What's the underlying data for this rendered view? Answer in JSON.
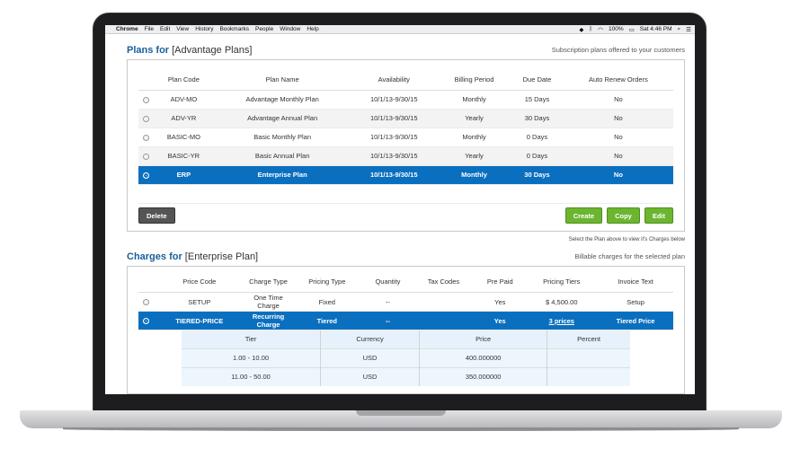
{
  "menubar": {
    "apple": "",
    "items": [
      "Chrome",
      "File",
      "Edit",
      "View",
      "History",
      "Bookmarks",
      "People",
      "Window",
      "Help"
    ],
    "battery": "100%",
    "clock": "Sat 4:46 PM"
  },
  "plans": {
    "title_prefix": "Plans for ",
    "title_bracket": "[Advantage Plans]",
    "subtitle": "Subscription plans offered to your customers",
    "headers": [
      "Plan Code",
      "Plan Name",
      "Availability",
      "Billing Period",
      "Due Date",
      "Auto Renew Orders"
    ],
    "rows": [
      [
        "ADV-MO",
        "Advantage Monthly Plan",
        "10/1/13-9/30/15",
        "Monthly",
        "15 Days",
        "No"
      ],
      [
        "ADV-YR",
        "Advantage Annual Plan",
        "10/1/13-9/30/15",
        "Yearly",
        "30 Days",
        "No"
      ],
      [
        "BASIC-MO",
        "Basic Monthly Plan",
        "10/1/13-9/30/15",
        "Monthly",
        "0 Days",
        "No"
      ],
      [
        "BASIC-YR",
        "Basic Annual Plan",
        "10/1/13-9/30/15",
        "Yearly",
        "0 Days",
        "No"
      ],
      [
        "ERP",
        "Enterprise Plan",
        "10/1/13-9/30/15",
        "Monthly",
        "30 Days",
        "No"
      ]
    ],
    "selected_index": 4,
    "delete_label": "Delete",
    "create_label": "Create",
    "copy_label": "Copy",
    "edit_label": "Edit",
    "note": "Select the Plan above to view it's Charges below"
  },
  "charges": {
    "title_prefix": "Charges for ",
    "title_bracket": "[Enterprise Plan]",
    "subtitle": "Billable charges for the selected plan",
    "headers": [
      "Price Code",
      "Charge Type",
      "Pricing Type",
      "Quantity",
      "Tax Codes",
      "Pre Paid",
      "Pricing Tiers",
      "Invoice Text"
    ],
    "rows": [
      [
        "SETUP",
        "One Time Charge",
        "Fixed",
        "--",
        "",
        "Yes",
        "$ 4,500.00",
        "Setup"
      ],
      [
        "TIERED-PRICE",
        "Recurring Charge",
        "Tiered",
        "--",
        "",
        "Yes",
        "3 prices",
        "Tiered Price"
      ]
    ],
    "tier_headers": [
      "Tier",
      "Currency",
      "Price",
      "Percent"
    ],
    "tiers": [
      [
        "1.00 - 10.00",
        "USD",
        "400.000000",
        ""
      ],
      [
        "11.00 - 50.00",
        "USD",
        "350.000000",
        ""
      ]
    ]
  },
  "colors": {
    "accent": "#0b6fbf",
    "title": "#1a5e9e",
    "button_green": "#6bb52f"
  }
}
